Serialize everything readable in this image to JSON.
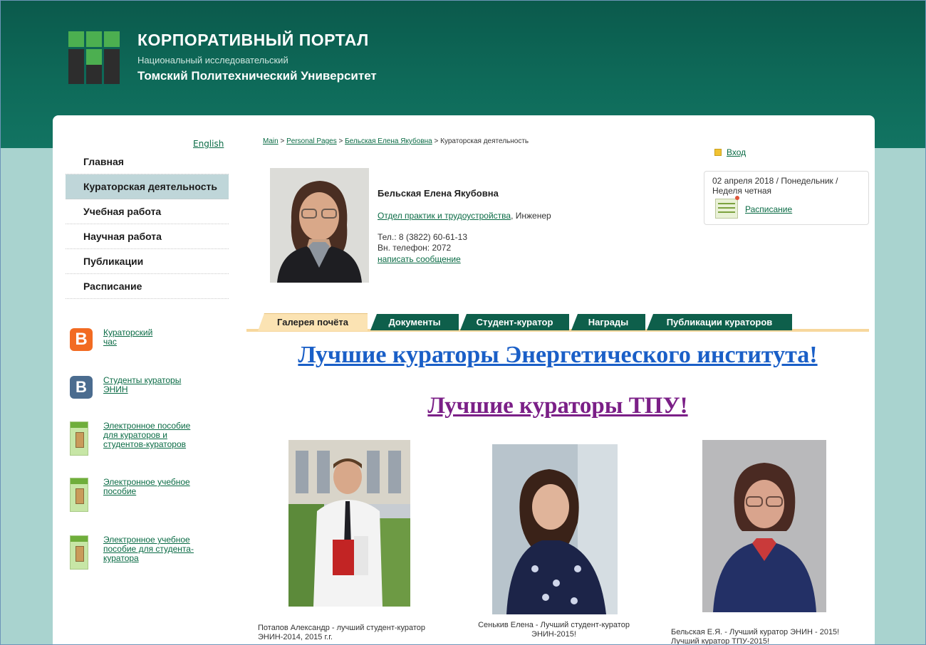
{
  "brand": {
    "title": "КОРПОРАТИВНЫЙ ПОРТАЛ",
    "subtitle": "Национальный исследовательский",
    "university": "Томский Политехнический Университет"
  },
  "sidebar": {
    "lang_link": "English",
    "nav": [
      {
        "label": "Главная"
      },
      {
        "label": "Кураторская деятельность",
        "active": true
      },
      {
        "label": "Учебная работа"
      },
      {
        "label": "Научная работа"
      },
      {
        "label": "Публикации"
      },
      {
        "label": "Расписание"
      }
    ],
    "links": [
      {
        "label": "Кураторский час",
        "icon": "blogger-icon"
      },
      {
        "label": "Студенты кураторы ЭНИН",
        "icon": "vk-icon"
      },
      {
        "label": "Электронное пособие для кураторов и студентов-кураторов",
        "icon": "ebook-icon"
      },
      {
        "label": "Электронное учебное пособие",
        "icon": "ebook-icon"
      },
      {
        "label": "Электронное учебное пособие для студента-куратора",
        "icon": "ebook-icon"
      }
    ]
  },
  "breadcrumb": {
    "items": [
      "Main",
      "Personal Pages",
      "Бельская Елена Якубовна"
    ],
    "separator": ">",
    "current": "Кураторская деятельность"
  },
  "account": {
    "login_label": "Вход"
  },
  "datebox": {
    "date_text": "02 апреля 2018 / Понедельник / Неделя четная",
    "schedule_link": "Расписание"
  },
  "profile": {
    "name": "Бельская Елена Якубовна",
    "department": "Отдел практик и трудоустройства",
    "position": ", Инженер",
    "phone": "Тел.: 8 (3822) 60-61-13",
    "internal_phone": "Вн. телефон: 2072",
    "message_link": "написать сообщение"
  },
  "tabs": [
    {
      "label": "Галерея почёта",
      "active": true
    },
    {
      "label": "Документы"
    },
    {
      "label": "Студент-куратор"
    },
    {
      "label": "Награды"
    },
    {
      "label": "Публикации кураторов"
    }
  ],
  "content": {
    "heading_institute": "Лучшие кураторы Энергетического института!",
    "heading_tpu": "Лучшие кураторы ТПУ!",
    "gallery": [
      {
        "caption": "Потапов Александр - лучший студент-куратор ЭНИН-2014, 2015 г.г."
      },
      {
        "caption": "Сенькив Елена - Лучший студент-куратор ЭНИН-2015!"
      },
      {
        "caption": "Бельская Е.Я. - Лучший куратор ЭНИН - 2015! Лучший куратор ТПУ-2015!"
      }
    ]
  },
  "colors": {
    "header_green": "#0e6a59",
    "background_teal": "#a9d3cf",
    "link_green": "#0a6b45",
    "active_nav": "#bfd6d9",
    "tab_green": "#0e5f4b",
    "tab_active": "#fbe3b3",
    "heading_blue": "#1a5fc7",
    "heading_purple": "#7b1f87"
  }
}
